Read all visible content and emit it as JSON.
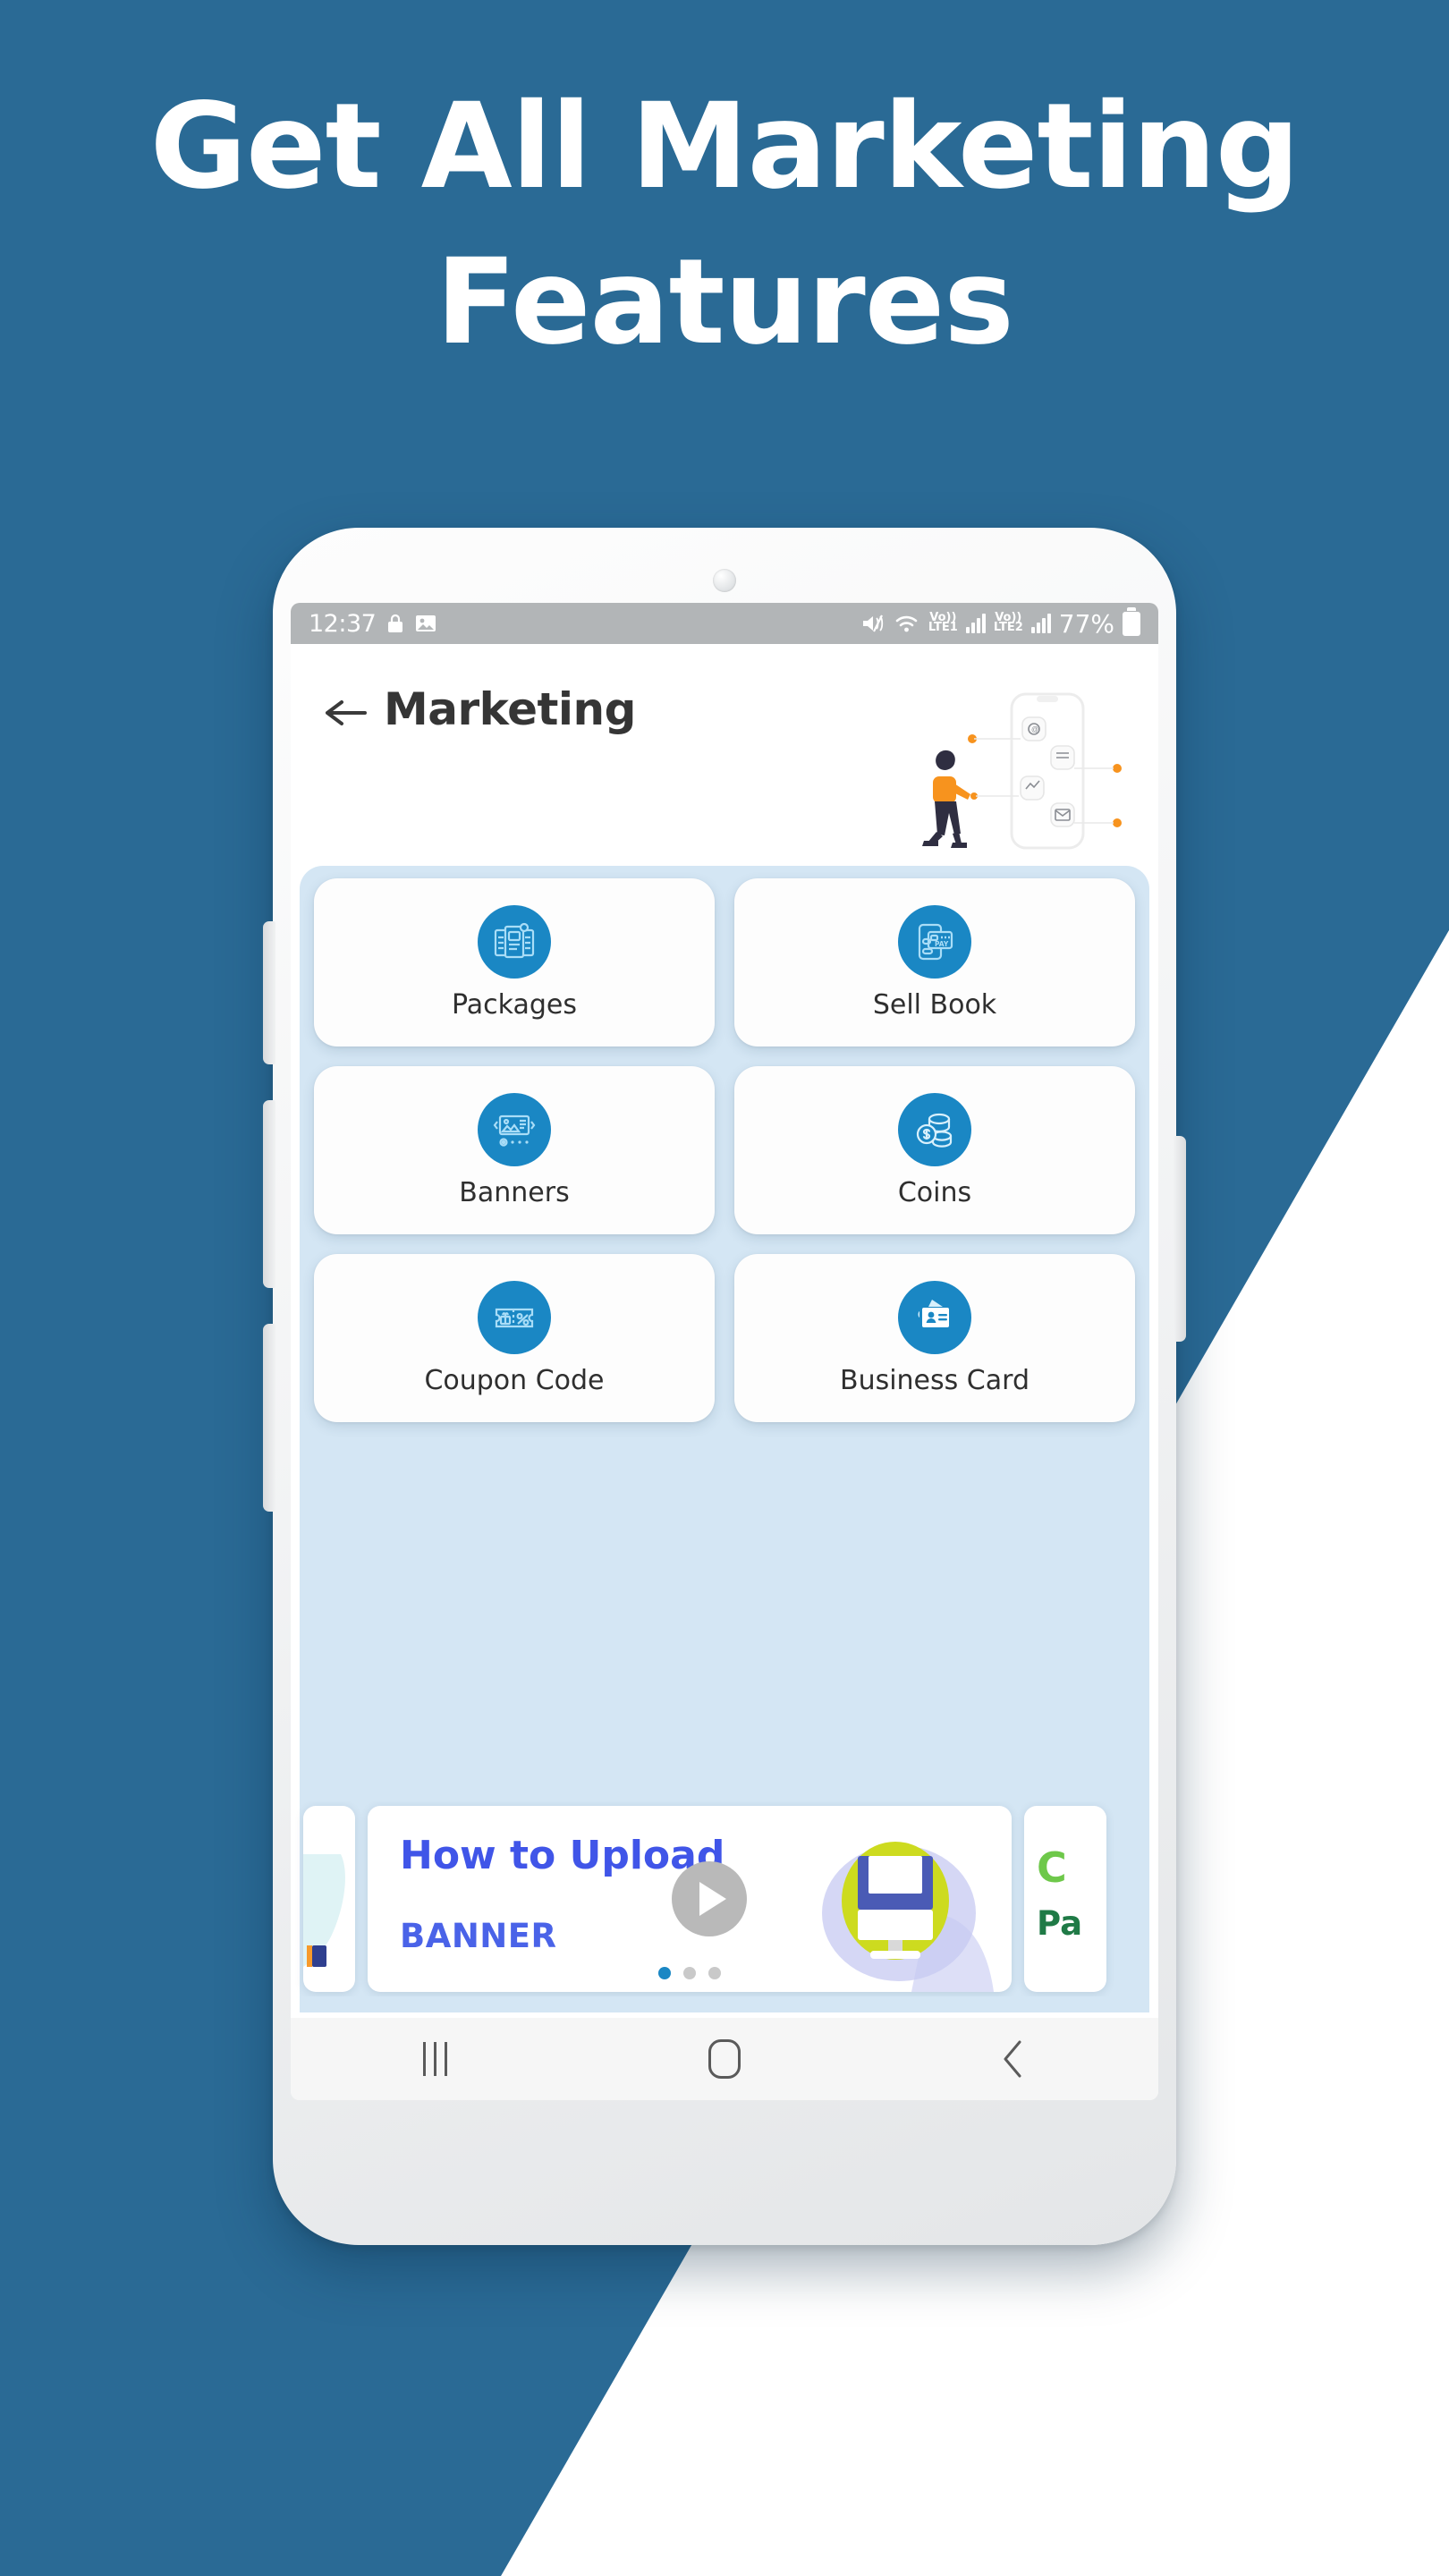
{
  "poster": {
    "background_color": "#2a6a95",
    "headline_line1": "Get All Marketing",
    "headline_line2": "Features"
  },
  "phone": {
    "status_bar": {
      "time": "12:37",
      "icons_left": [
        "lock-icon",
        "image-icon"
      ],
      "icons_right": [
        "mute-icon",
        "wifi-icon",
        "volte1-icon",
        "signal-bars-icon",
        "volte2-icon",
        "signal-bars-icon"
      ],
      "volte1_label": "Vo))",
      "volte1_sub": "LTE1",
      "volte2_label": "Vo))",
      "volte2_sub": "LTE2",
      "battery_percent": "77%"
    },
    "app_header": {
      "back_icon": "arrow-left-icon",
      "title": "Marketing",
      "illustration": "marketing-person-phone-illustration"
    },
    "grid": {
      "accent_color": "#1a87c4",
      "panel_color": "#d4e6f4",
      "items": [
        {
          "label": "Packages",
          "icon": "packages-icon"
        },
        {
          "label": "Sell Book",
          "icon": "pay-phone-icon"
        },
        {
          "label": "Banners",
          "icon": "banner-slideshow-icon"
        },
        {
          "label": "Coins",
          "icon": "coins-icon"
        },
        {
          "label": "Coupon Code",
          "icon": "coupon-percent-icon"
        },
        {
          "label": "Business Card",
          "icon": "business-card-icon"
        }
      ]
    },
    "carousel": {
      "current_slide": {
        "title_line1": "How to Upload",
        "title_line2": "BANNER",
        "play_icon": "play-icon",
        "thumbnail": "monitor-graphic"
      },
      "next_slide": {
        "title_line1": "C",
        "title_line2": "Pa"
      },
      "dots_total": 3,
      "dot_active_index": 0,
      "active_dot_color": "#1a87c4",
      "inactive_dot_color": "#c9c9c9"
    },
    "nav_bar": {
      "recents_label": "recents-icon",
      "home_label": "home-icon",
      "back_label": "back-icon"
    }
  }
}
